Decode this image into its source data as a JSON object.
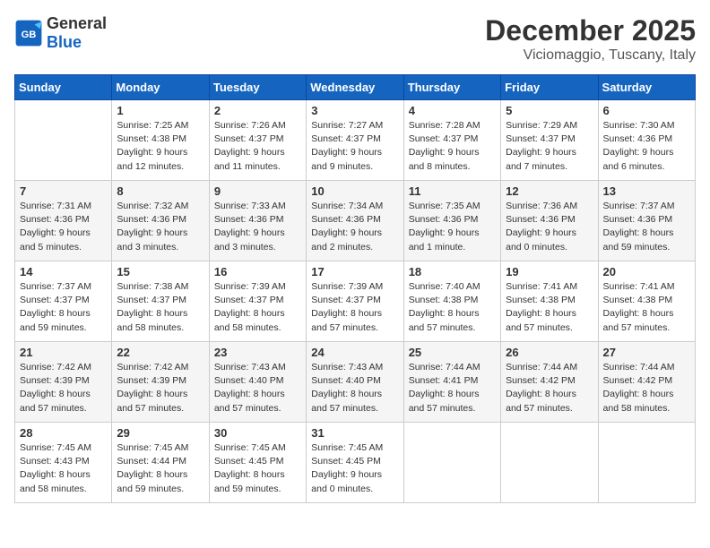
{
  "header": {
    "logo_general": "General",
    "logo_blue": "Blue",
    "month_title": "December 2025",
    "location": "Viciomaggio, Tuscany, Italy"
  },
  "days_of_week": [
    "Sunday",
    "Monday",
    "Tuesday",
    "Wednesday",
    "Thursday",
    "Friday",
    "Saturday"
  ],
  "weeks": [
    [
      {
        "day": "",
        "info": ""
      },
      {
        "day": "1",
        "info": "Sunrise: 7:25 AM\nSunset: 4:38 PM\nDaylight: 9 hours\nand 12 minutes."
      },
      {
        "day": "2",
        "info": "Sunrise: 7:26 AM\nSunset: 4:37 PM\nDaylight: 9 hours\nand 11 minutes."
      },
      {
        "day": "3",
        "info": "Sunrise: 7:27 AM\nSunset: 4:37 PM\nDaylight: 9 hours\nand 9 minutes."
      },
      {
        "day": "4",
        "info": "Sunrise: 7:28 AM\nSunset: 4:37 PM\nDaylight: 9 hours\nand 8 minutes."
      },
      {
        "day": "5",
        "info": "Sunrise: 7:29 AM\nSunset: 4:37 PM\nDaylight: 9 hours\nand 7 minutes."
      },
      {
        "day": "6",
        "info": "Sunrise: 7:30 AM\nSunset: 4:36 PM\nDaylight: 9 hours\nand 6 minutes."
      }
    ],
    [
      {
        "day": "7",
        "info": "Sunrise: 7:31 AM\nSunset: 4:36 PM\nDaylight: 9 hours\nand 5 minutes."
      },
      {
        "day": "8",
        "info": "Sunrise: 7:32 AM\nSunset: 4:36 PM\nDaylight: 9 hours\nand 3 minutes."
      },
      {
        "day": "9",
        "info": "Sunrise: 7:33 AM\nSunset: 4:36 PM\nDaylight: 9 hours\nand 3 minutes."
      },
      {
        "day": "10",
        "info": "Sunrise: 7:34 AM\nSunset: 4:36 PM\nDaylight: 9 hours\nand 2 minutes."
      },
      {
        "day": "11",
        "info": "Sunrise: 7:35 AM\nSunset: 4:36 PM\nDaylight: 9 hours\nand 1 minute."
      },
      {
        "day": "12",
        "info": "Sunrise: 7:36 AM\nSunset: 4:36 PM\nDaylight: 9 hours\nand 0 minutes."
      },
      {
        "day": "13",
        "info": "Sunrise: 7:37 AM\nSunset: 4:36 PM\nDaylight: 8 hours\nand 59 minutes."
      }
    ],
    [
      {
        "day": "14",
        "info": "Sunrise: 7:37 AM\nSunset: 4:37 PM\nDaylight: 8 hours\nand 59 minutes."
      },
      {
        "day": "15",
        "info": "Sunrise: 7:38 AM\nSunset: 4:37 PM\nDaylight: 8 hours\nand 58 minutes."
      },
      {
        "day": "16",
        "info": "Sunrise: 7:39 AM\nSunset: 4:37 PM\nDaylight: 8 hours\nand 58 minutes."
      },
      {
        "day": "17",
        "info": "Sunrise: 7:39 AM\nSunset: 4:37 PM\nDaylight: 8 hours\nand 57 minutes."
      },
      {
        "day": "18",
        "info": "Sunrise: 7:40 AM\nSunset: 4:38 PM\nDaylight: 8 hours\nand 57 minutes."
      },
      {
        "day": "19",
        "info": "Sunrise: 7:41 AM\nSunset: 4:38 PM\nDaylight: 8 hours\nand 57 minutes."
      },
      {
        "day": "20",
        "info": "Sunrise: 7:41 AM\nSunset: 4:38 PM\nDaylight: 8 hours\nand 57 minutes."
      }
    ],
    [
      {
        "day": "21",
        "info": "Sunrise: 7:42 AM\nSunset: 4:39 PM\nDaylight: 8 hours\nand 57 minutes."
      },
      {
        "day": "22",
        "info": "Sunrise: 7:42 AM\nSunset: 4:39 PM\nDaylight: 8 hours\nand 57 minutes."
      },
      {
        "day": "23",
        "info": "Sunrise: 7:43 AM\nSunset: 4:40 PM\nDaylight: 8 hours\nand 57 minutes."
      },
      {
        "day": "24",
        "info": "Sunrise: 7:43 AM\nSunset: 4:40 PM\nDaylight: 8 hours\nand 57 minutes."
      },
      {
        "day": "25",
        "info": "Sunrise: 7:44 AM\nSunset: 4:41 PM\nDaylight: 8 hours\nand 57 minutes."
      },
      {
        "day": "26",
        "info": "Sunrise: 7:44 AM\nSunset: 4:42 PM\nDaylight: 8 hours\nand 57 minutes."
      },
      {
        "day": "27",
        "info": "Sunrise: 7:44 AM\nSunset: 4:42 PM\nDaylight: 8 hours\nand 58 minutes."
      }
    ],
    [
      {
        "day": "28",
        "info": "Sunrise: 7:45 AM\nSunset: 4:43 PM\nDaylight: 8 hours\nand 58 minutes."
      },
      {
        "day": "29",
        "info": "Sunrise: 7:45 AM\nSunset: 4:44 PM\nDaylight: 8 hours\nand 59 minutes."
      },
      {
        "day": "30",
        "info": "Sunrise: 7:45 AM\nSunset: 4:45 PM\nDaylight: 8 hours\nand 59 minutes."
      },
      {
        "day": "31",
        "info": "Sunrise: 7:45 AM\nSunset: 4:45 PM\nDaylight: 9 hours\nand 0 minutes."
      },
      {
        "day": "",
        "info": ""
      },
      {
        "day": "",
        "info": ""
      },
      {
        "day": "",
        "info": ""
      }
    ]
  ]
}
